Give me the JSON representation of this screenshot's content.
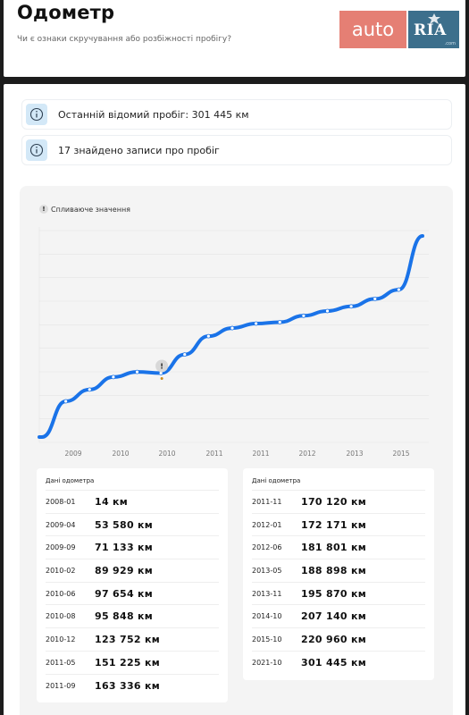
{
  "header": {
    "title": "Одометр",
    "subtitle": "Чи є ознаки скручування або розбіжності пробігу?",
    "logo": {
      "left_text": "auto",
      "right_text": "RIA",
      "small_text": ".com"
    }
  },
  "info": {
    "last_mileage": "Останній відомий пробіг: 301 445 км",
    "records_found": "17 знайдено записи про пробіг"
  },
  "chart": {
    "legend_label": "Спливаюче значення",
    "legend_icon": "!",
    "colors": {
      "line": "#1a73e8",
      "grid": "#e3e3e3",
      "warn_dot": "#c98a1c"
    }
  },
  "chart_data": {
    "type": "line",
    "x_ticks": [
      "2009",
      "2010",
      "2010",
      "2011",
      "2011",
      "2012",
      "2013",
      "2015"
    ],
    "series": [
      {
        "points": [
          {
            "x": "2008-01",
            "y": 14
          },
          {
            "x": "2009-04",
            "y": 53580
          },
          {
            "x": "2009-09",
            "y": 71133
          },
          {
            "x": "2010-02",
            "y": 89929
          },
          {
            "x": "2010-06",
            "y": 97654
          },
          {
            "x": "2010-08",
            "y": 95848
          },
          {
            "x": "2010-12",
            "y": 123752
          },
          {
            "x": "2011-05",
            "y": 151225
          },
          {
            "x": "2011-09",
            "y": 163336
          },
          {
            "x": "2011-11",
            "y": 170120
          },
          {
            "x": "2012-01",
            "y": 172171
          },
          {
            "x": "2012-06",
            "y": 181801
          },
          {
            "x": "2013-05",
            "y": 188898
          },
          {
            "x": "2013-11",
            "y": 195870
          },
          {
            "x": "2014-10",
            "y": 207140
          },
          {
            "x": "2015-10",
            "y": 220960
          },
          {
            "x": "2021-10",
            "y": 301445
          }
        ]
      }
    ],
    "anomaly": {
      "x": "2010-08",
      "y": 95848,
      "marker": "!"
    }
  },
  "tables": [
    {
      "title": "Дані одометра",
      "rows": [
        {
          "date": "2008-01",
          "value": "14 км"
        },
        {
          "date": "2009-04",
          "value": "53 580 км"
        },
        {
          "date": "2009-09",
          "value": "71 133 км"
        },
        {
          "date": "2010-02",
          "value": "89 929 км"
        },
        {
          "date": "2010-06",
          "value": "97 654 км"
        },
        {
          "date": "2010-08",
          "value": "95 848 км"
        },
        {
          "date": "2010-12",
          "value": "123 752 км"
        },
        {
          "date": "2011-05",
          "value": "151 225 км"
        },
        {
          "date": "2011-09",
          "value": "163 336 км"
        }
      ]
    },
    {
      "title": "Дані одометра",
      "rows": [
        {
          "date": "2011-11",
          "value": "170 120 км"
        },
        {
          "date": "2012-01",
          "value": "172 171 км"
        },
        {
          "date": "2012-06",
          "value": "181 801 км"
        },
        {
          "date": "2013-05",
          "value": "188 898 км"
        },
        {
          "date": "2013-11",
          "value": "195 870 км"
        },
        {
          "date": "2014-10",
          "value": "207 140 км"
        },
        {
          "date": "2015-10",
          "value": "220 960 км"
        },
        {
          "date": "2021-10",
          "value": "301 445 км"
        }
      ]
    }
  ]
}
